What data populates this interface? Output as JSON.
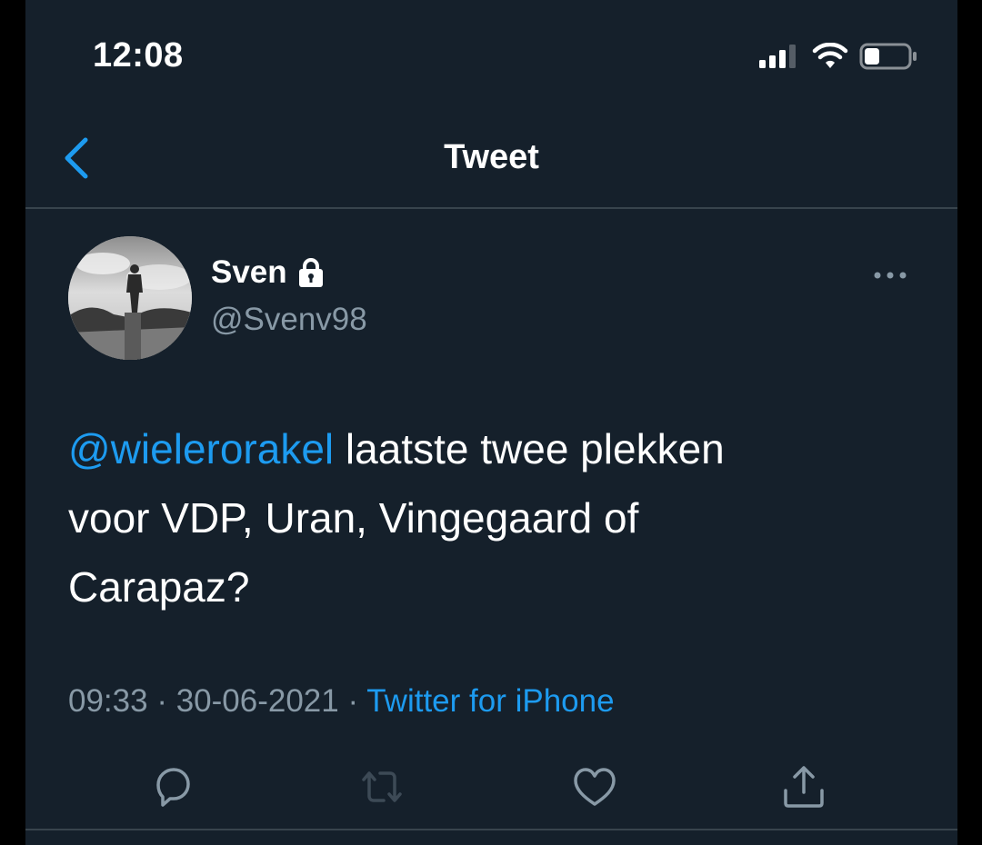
{
  "status_bar": {
    "time": "12:08",
    "icons": [
      "cellular-signal-icon",
      "wifi-icon",
      "battery-icon"
    ],
    "battery_level": 0.35
  },
  "nav": {
    "back_icon": "chevron-left-icon",
    "title": "Tweet"
  },
  "tweet": {
    "author": {
      "name": "Sven",
      "handle": "@Svenv98",
      "protected_icon": "lock-icon"
    },
    "more_icon": "ellipsis-icon",
    "text": {
      "mention": "@wielerorakel",
      "line1_rest": " laatste twee plekken",
      "line2": "voor VDP, Uran, Vingegaard of",
      "line3": "Carapaz?"
    },
    "meta": {
      "time": "09:33",
      "separator1": " · ",
      "date": "30-06-2021",
      "separator2": " · ",
      "source": "Twitter for iPhone"
    },
    "actions": [
      "reply-icon",
      "retweet-icon",
      "like-icon",
      "share-icon"
    ]
  },
  "colors": {
    "background": "#15202b",
    "accent": "#1d9bf0",
    "secondary_text": "#8899a6",
    "divider": "#38444d"
  }
}
